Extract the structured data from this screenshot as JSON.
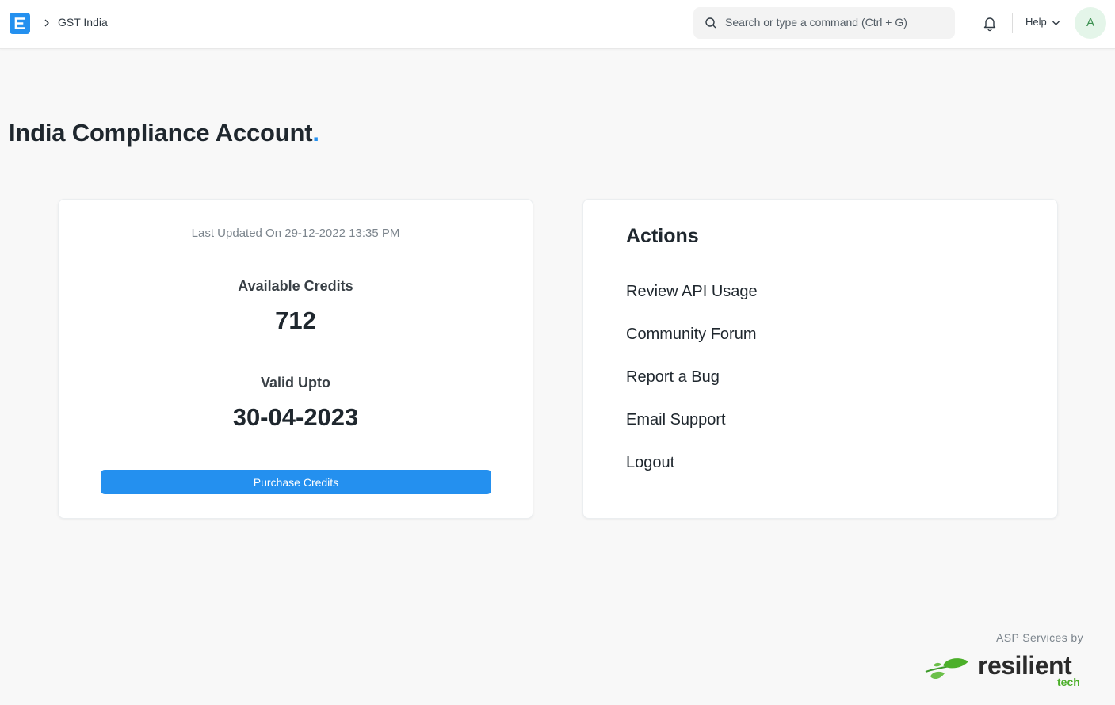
{
  "navbar": {
    "breadcrumb": "GST India",
    "search_placeholder": "Search or type a command (Ctrl + G)",
    "help_label": "Help",
    "avatar_initial": "A"
  },
  "page": {
    "title": "India Compliance Account",
    "title_dot": "."
  },
  "account_card": {
    "last_updated": "Last Updated On 29-12-2022 13:35 PM",
    "available_credits_label": "Available Credits",
    "available_credits_value": "712",
    "valid_upto_label": "Valid Upto",
    "valid_upto_value": "30-04-2023",
    "purchase_button": "Purchase Credits"
  },
  "actions_card": {
    "title": "Actions",
    "items": [
      {
        "label": "Review API Usage"
      },
      {
        "label": "Community Forum"
      },
      {
        "label": "Report a Bug"
      },
      {
        "label": "Email Support"
      },
      {
        "label": "Logout"
      }
    ]
  },
  "footer": {
    "asp_label": "ASP Services by",
    "brand_name": "resilient",
    "brand_sub": "tech"
  },
  "colors": {
    "accent": "#2490ef",
    "brand_green": "#4caf2a",
    "avatar_bg": "#e4f5e9"
  },
  "icons": [
    "erpnext-logo-icon",
    "chevron-right-icon",
    "search-icon",
    "bell-icon",
    "chevron-down-icon",
    "leaf-icon"
  ]
}
